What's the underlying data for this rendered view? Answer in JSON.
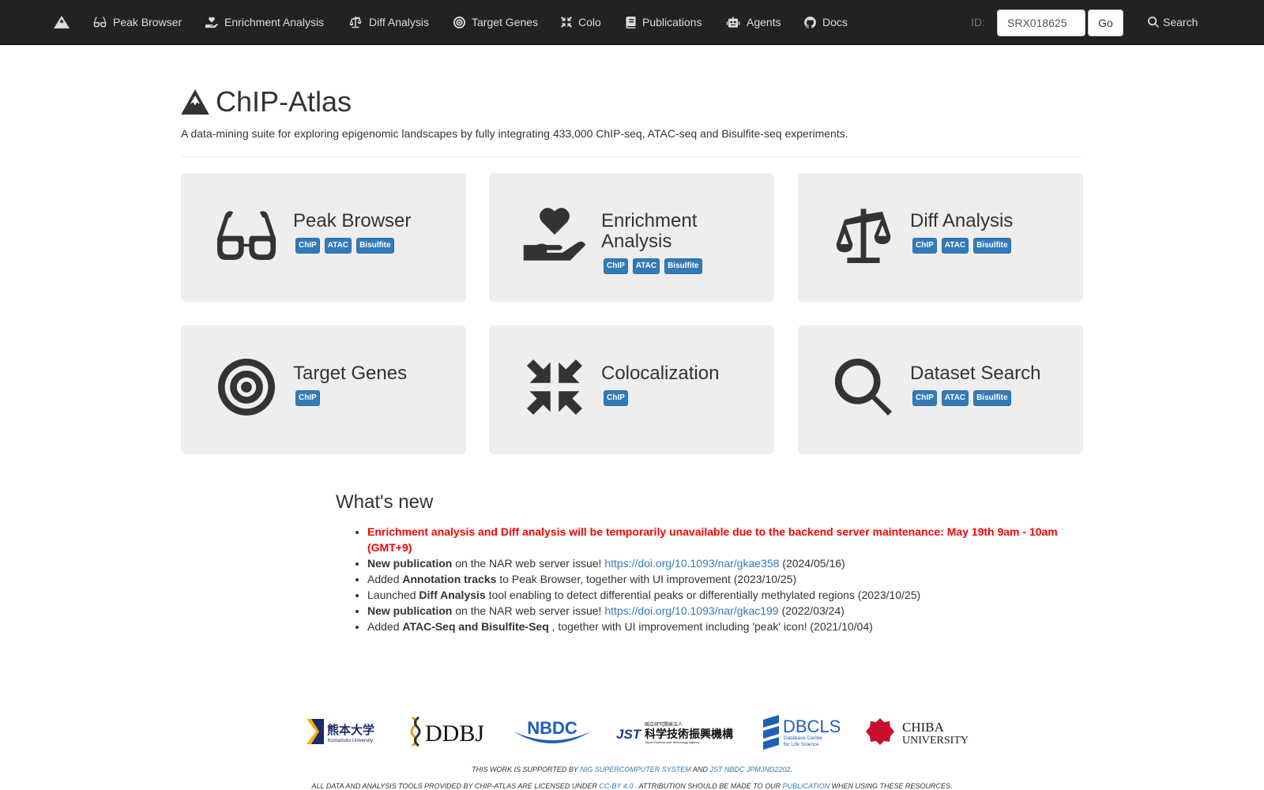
{
  "navbar": {
    "items": [
      {
        "label": "Peak Browser",
        "icon": "glasses-icon"
      },
      {
        "label": "Enrichment Analysis",
        "icon": "hand-holding-heart-icon"
      },
      {
        "label": "Diff Analysis",
        "icon": "scale-icon"
      },
      {
        "label": "Target Genes",
        "icon": "bullseye-icon"
      },
      {
        "label": "Colo",
        "icon": "compress-icon"
      },
      {
        "label": "Publications",
        "icon": "book-icon"
      },
      {
        "label": "Agents",
        "icon": "robot-icon"
      },
      {
        "label": "Docs",
        "icon": "github-icon"
      }
    ],
    "id_label": "ID:",
    "id_value": "SRX018625",
    "go_label": "Go",
    "search_label": "Search"
  },
  "header": {
    "title": "ChIP-Atlas",
    "subtitle": "A data-mining suite for exploring epigenomic landscapes by fully integrating 433,000 ChIP-seq, ATAC-seq and Bisulfite-seq experiments."
  },
  "cards": [
    {
      "title": "Peak Browser",
      "labels": [
        "ChIP",
        "ATAC",
        "Bisulfite"
      ]
    },
    {
      "title": "Enrichment Analysis",
      "labels": [
        "ChIP",
        "ATAC",
        "Bisulfite"
      ]
    },
    {
      "title": "Diff Analysis",
      "labels": [
        "ChIP",
        "ATAC",
        "Bisulfite"
      ]
    },
    {
      "title": "Target Genes",
      "labels": [
        "ChIP"
      ]
    },
    {
      "title": "Colocalization",
      "labels": [
        "ChIP"
      ]
    },
    {
      "title": "Dataset Search",
      "labels": [
        "ChIP",
        "ATAC",
        "Bisulfite"
      ]
    }
  ],
  "whats_new": {
    "title": "What's new",
    "alert": "Enrichment analysis and Diff analysis will be temporarily unavailable due to the backend server maintenance: May 19th 9am - 10am (GMT+9)",
    "items": [
      {
        "pre": "",
        "bold": "New publication",
        "mid": " on the NAR web server issue! ",
        "link": "https://doi.org/10.1093/nar/gkae358",
        "post": " (2024/05/16)"
      },
      {
        "pre": "Added ",
        "bold": "Annotation tracks",
        "mid": " to Peak Browser, together with UI improvement (2023/10/25)",
        "link": "",
        "post": ""
      },
      {
        "pre": "Launched ",
        "bold": "Diff Analysis",
        "mid": " tool enabling to detect differential peaks or differentially methylated regions (2023/10/25)",
        "link": "",
        "post": ""
      },
      {
        "pre": "",
        "bold": "New publication",
        "mid": " on the NAR web server issue! ",
        "link": "https://doi.org/10.1093/nar/gkac199",
        "post": " (2022/03/24)"
      },
      {
        "pre": "Added ",
        "bold": "ATAC-Seq and Bisulfite-Seq",
        "mid": " , together with UI improvement including 'peak' icon! (2021/10/04)",
        "link": "",
        "post": ""
      }
    ]
  },
  "logos": {
    "kumamoto": {
      "jp": "熊本大学",
      "en": "Kumamoto University"
    },
    "ddbj": "DDBJ",
    "nbdc": "NBDC",
    "jst": {
      "short": "JST",
      "jp": "科学技術振興機構",
      "jp_small": "国立研究開発法人",
      "en": "Japan Science and Technology Agency"
    },
    "dbcls": {
      "short": "DBCLS",
      "en1": "Database Center",
      "en2": "for Life Science"
    },
    "chiba": {
      "l1": "CHIBA",
      "l2": "UNIVERSITY"
    }
  },
  "footer": {
    "support_pre": "This work is supported by ",
    "support_link1": "NIG supercomputer system",
    "support_mid": " and ",
    "support_link2": "JST NBDC JPMJND2202",
    "support_post": ".",
    "license_pre": "All data and analysis tools provided by ChIP-Atlas are licensed under ",
    "license_link": "CC-BY 4.0",
    "license_mid": " . Attribution should be made to our ",
    "license_link2": "publication",
    "license_post": " when using these resources."
  },
  "colors": {
    "navbar": "#222222",
    "label": "#337ab7",
    "alert": "#ff0000",
    "card": "#eeeeee"
  }
}
